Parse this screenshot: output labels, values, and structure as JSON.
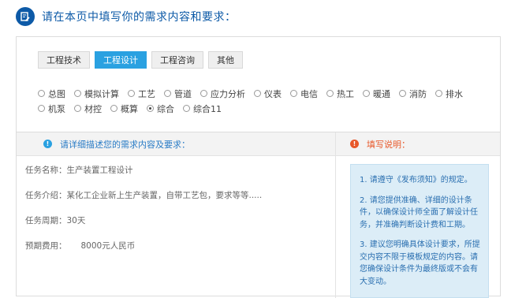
{
  "header": {
    "title": "请在本页中填写你的需求内容和要求："
  },
  "tabs": [
    {
      "label": "工程技术",
      "active": false
    },
    {
      "label": "工程设计",
      "active": true
    },
    {
      "label": "工程咨询",
      "active": false
    },
    {
      "label": "其他",
      "active": false
    }
  ],
  "categories": {
    "row1": [
      "总图",
      "模拟计算",
      "工艺",
      "管道",
      "应力分析",
      "仪表",
      "电信",
      "热工",
      "暖通",
      "消防",
      "排水"
    ],
    "row2": [
      "机泵",
      "材控",
      "概算",
      "综合",
      "综合11"
    ],
    "selected": "综合"
  },
  "left_panel": {
    "heading": "请详细描述您的需求内容及要求：",
    "task_name_label": "任务名称：",
    "task_name_value": "生产装置工程设计",
    "task_intro_label": "任务介绍：",
    "task_intro_value": "某化工企业新上生产装置，自带工艺包，要求等等.....",
    "task_period_label": "任务周期：",
    "task_period_value": "30天",
    "expected_fee_label": "预期费用：",
    "expected_fee_value": "8000元人民币"
  },
  "right_panel": {
    "heading": "填写说明：",
    "notes": [
      "1. 请遵守《发布须知》的规定。",
      "2. 请您提供准确、详细的设计条件，以确保设计师全面了解设计任务，并准确判断设计费和工期。",
      "3. 建议您明确具体设计要求，所提交内容不限于模板规定的内容。请您确保设计条件为最终版或不会有大变动。"
    ]
  },
  "colors": {
    "brand_blue": "#0d5aa7",
    "tab_active": "#2aa1e1",
    "warn_orange": "#e8582a",
    "note_bg": "#dcedf7"
  }
}
